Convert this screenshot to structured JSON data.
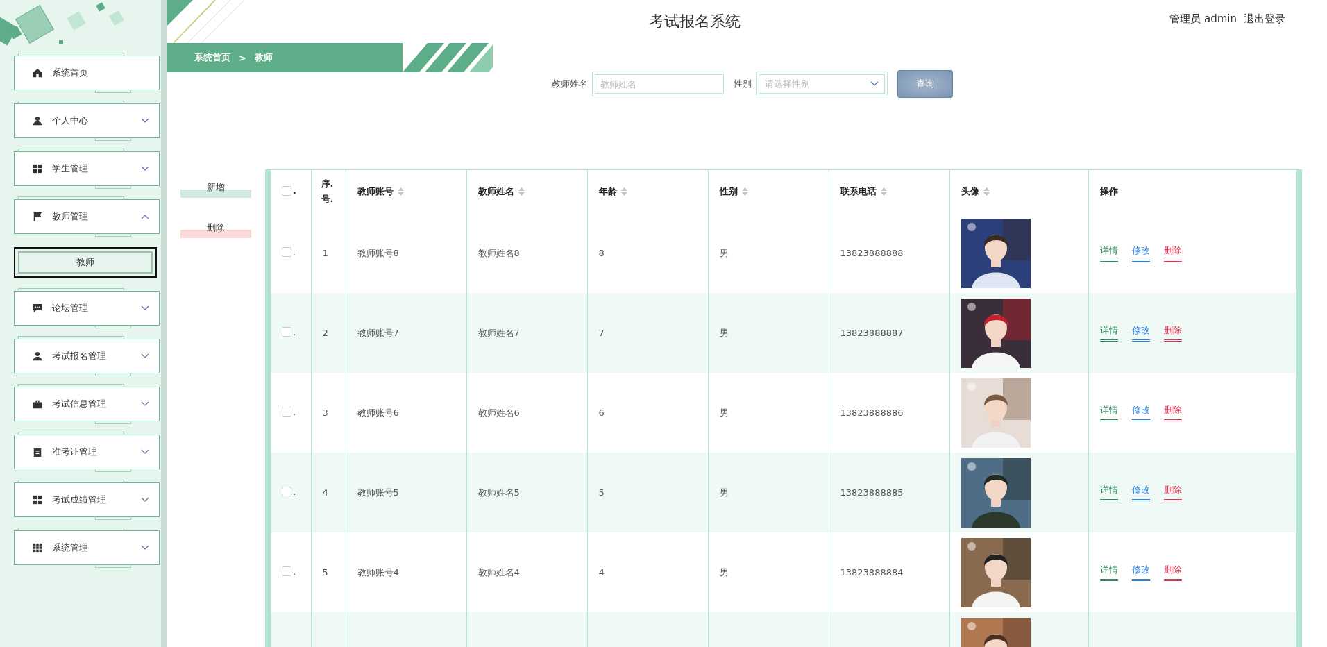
{
  "header": {
    "title": "考试报名系统",
    "user": "管理员 admin",
    "logout": "退出登录"
  },
  "breadcrumb": [
    "系统首页",
    "教师"
  ],
  "breadcrumb_separator": ">",
  "sidebar": {
    "items": [
      {
        "label": "系统首页",
        "kind": "home"
      },
      {
        "label": "个人中心",
        "kind": "person",
        "expanded": false
      },
      {
        "label": "学生管理",
        "kind": "grid",
        "expanded": false
      },
      {
        "label": "教师管理",
        "kind": "flag",
        "expanded": true,
        "children": [
          {
            "label": "教师",
            "selected": true
          }
        ]
      },
      {
        "label": "论坛管理",
        "kind": "chat",
        "expanded": false
      },
      {
        "label": "考试报名管理",
        "kind": "person",
        "expanded": false
      },
      {
        "label": "考试信息管理",
        "kind": "briefcase",
        "expanded": false
      },
      {
        "label": "准考证管理",
        "kind": "clipboard",
        "expanded": false
      },
      {
        "label": "考试成绩管理",
        "kind": "grid",
        "expanded": false
      },
      {
        "label": "系统管理",
        "kind": "apps",
        "expanded": false
      }
    ]
  },
  "search": {
    "fields": [
      {
        "label": "教师姓名",
        "kind": "text",
        "placeholder": "教师姓名"
      },
      {
        "label": "性别",
        "kind": "select",
        "placeholder": "请选择性别"
      }
    ],
    "button": "查询"
  },
  "actions": [
    {
      "label": "新增",
      "kind": "add"
    },
    {
      "label": "删除",
      "kind": "delete"
    }
  ],
  "table": {
    "all_checked": false,
    "checkbox_suffix": ".",
    "columns": [
      {
        "label": "序.号.",
        "sortable": false
      },
      {
        "label": "教师账号",
        "sortable": true
      },
      {
        "label": "教师姓名",
        "sortable": true
      },
      {
        "label": "年龄",
        "sortable": true
      },
      {
        "label": "性别",
        "sortable": true
      },
      {
        "label": "联系电话",
        "sortable": true
      },
      {
        "label": "头像",
        "sortable": true
      },
      {
        "label": "操作",
        "sortable": false
      }
    ],
    "rows": [
      {
        "checked": false,
        "cells": [
          "1",
          "教师账号8",
          "教师姓名8",
          "8",
          "男",
          "13823888888"
        ],
        "avatar": {
          "kind": "picture"
        },
        "actions": [
          {
            "label": "详情",
            "kind": "detail"
          },
          {
            "label": "修改",
            "kind": "edit"
          },
          {
            "label": "删除",
            "kind": "delete"
          }
        ]
      },
      {
        "checked": false,
        "cells": [
          "2",
          "教师账号7",
          "教师姓名7",
          "7",
          "男",
          "13823888887"
        ],
        "avatar": {
          "kind": "picture"
        },
        "actions": [
          {
            "label": "详情",
            "kind": "detail"
          },
          {
            "label": "修改",
            "kind": "edit"
          },
          {
            "label": "删除",
            "kind": "delete"
          }
        ]
      },
      {
        "checked": false,
        "cells": [
          "3",
          "教师账号6",
          "教师姓名6",
          "6",
          "男",
          "13823888886"
        ],
        "avatar": {
          "kind": "picture"
        },
        "actions": [
          {
            "label": "详情",
            "kind": "detail"
          },
          {
            "label": "修改",
            "kind": "edit"
          },
          {
            "label": "删除",
            "kind": "delete"
          }
        ]
      },
      {
        "checked": false,
        "cells": [
          "4",
          "教师账号5",
          "教师姓名5",
          "5",
          "男",
          "13823888885"
        ],
        "avatar": {
          "kind": "picture"
        },
        "actions": [
          {
            "label": "详情",
            "kind": "detail"
          },
          {
            "label": "修改",
            "kind": "edit"
          },
          {
            "label": "删除",
            "kind": "delete"
          }
        ]
      },
      {
        "checked": false,
        "cells": [
          "5",
          "教师账号4",
          "教师姓名4",
          "4",
          "男",
          "13823888884"
        ],
        "avatar": {
          "kind": "picture"
        },
        "actions": [
          {
            "label": "详情",
            "kind": "detail"
          },
          {
            "label": "修改",
            "kind": "edit"
          },
          {
            "label": "删除",
            "kind": "delete"
          }
        ]
      },
      {
        "cells": [],
        "avatar": {
          "kind": "picture"
        },
        "actions": []
      }
    ]
  }
}
